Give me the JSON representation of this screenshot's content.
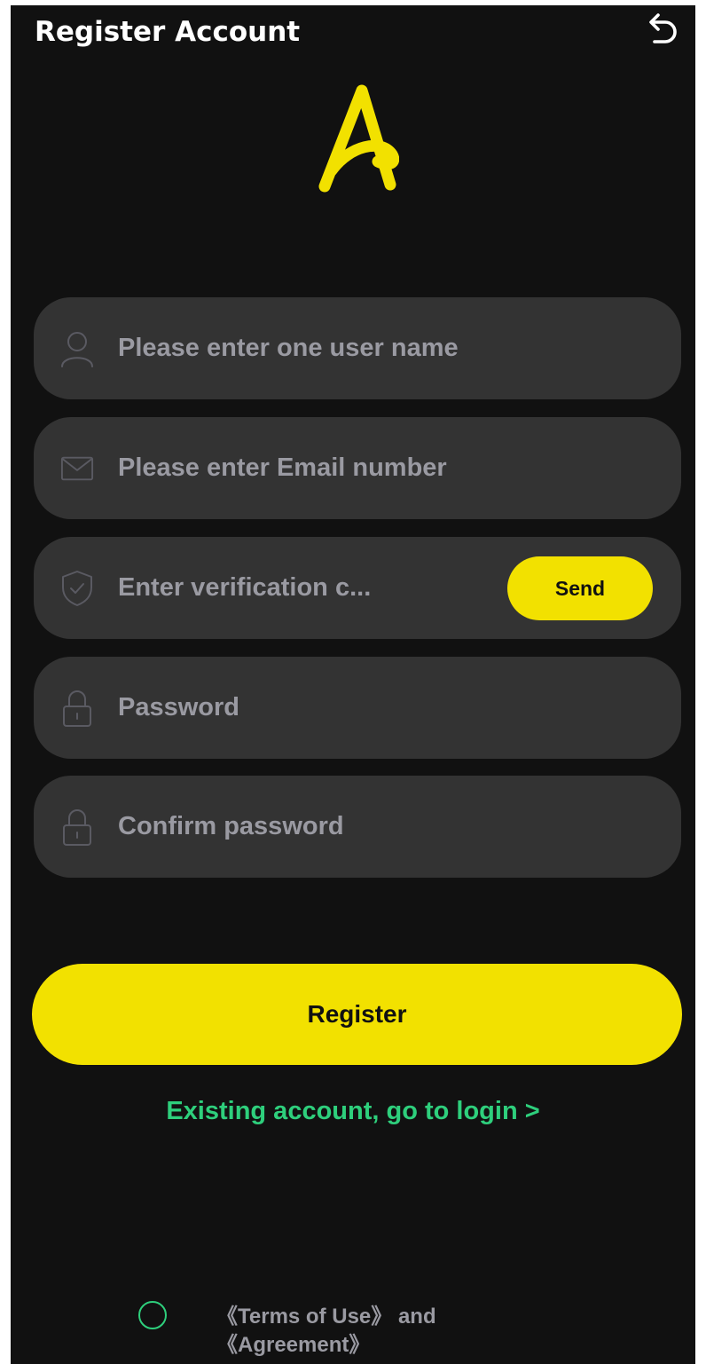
{
  "header": {
    "title": "Register Account",
    "back_icon": "undo-arrow-icon"
  },
  "logo": {
    "icon": "brand-letter-a-logo",
    "color": "#F2E100"
  },
  "form": {
    "username": {
      "placeholder": "Please enter one user name",
      "icon": "user-icon"
    },
    "email": {
      "placeholder": "Please enter Email number",
      "icon": "envelope-icon"
    },
    "verification": {
      "placeholder": "Enter verification c...",
      "icon": "shield-check-icon",
      "send_label": "Send"
    },
    "password": {
      "placeholder": "Password",
      "icon": "lock-icon"
    },
    "confirm_password": {
      "placeholder": "Confirm password",
      "icon": "lock-icon"
    }
  },
  "actions": {
    "register_label": "Register",
    "login_link": "Existing account, go to login >"
  },
  "agreement": {
    "terms_link": "《Terms of Use》",
    "and_text": " and",
    "agreement_link": "《Agreement》"
  },
  "colors": {
    "accent": "#F2E100",
    "link": "#2ECF7C",
    "background": "#111111",
    "field": "#333333",
    "placeholder": "#9A9AA2"
  }
}
